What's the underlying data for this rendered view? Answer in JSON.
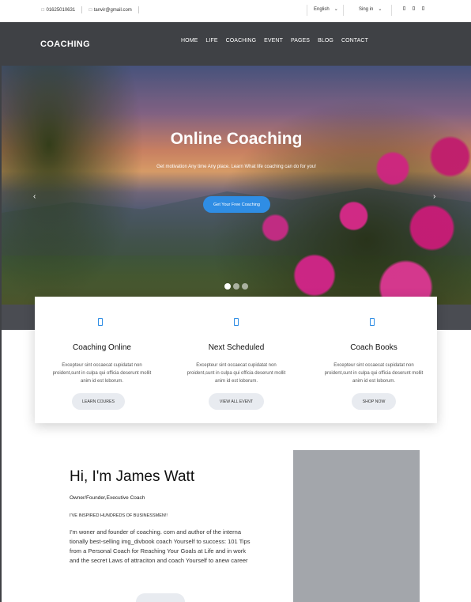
{
  "topbar": {
    "phone": "01625010631",
    "email": "tanvir@gmail.com",
    "language": "English",
    "signin": "Sing in",
    "phone_icon": "phone-icon",
    "email_icon": "mail-icon",
    "social_icons": [
      "facebook-icon",
      "twitter-icon",
      "instagram-icon"
    ]
  },
  "nav": {
    "brand": "COACHING",
    "items": [
      "HOME",
      "LIFE",
      "COACHING",
      "EVENT",
      "PAGES",
      "BLOG",
      "CONTACT"
    ]
  },
  "hero": {
    "title": "Online Coaching",
    "subtitle": "Get motivation Any time Any place. Learn What life coaching can do for you!",
    "cta_label": "Get Your Free Coaching",
    "slide_count": 3,
    "active_slide": 1
  },
  "cards": [
    {
      "icon": "monitor-icon",
      "title": "Coaching Online",
      "text": "Excepteur sint occaecat cupidatat non proident,sunt in culpa qui officia deserunt mollit anim id est loborum.",
      "button": "LEARN COURES"
    },
    {
      "icon": "calendar-icon",
      "title": "Next Scheduled",
      "text": "Excepteur sint occaecat cupidatat non proident,sunt in culpa qui officia deserunt mollit anim id est loborum.",
      "button": "VIEW ALL EVENT"
    },
    {
      "icon": "book-icon",
      "title": "Coach Books",
      "text": "Excepteur sint occaecat cupidatat non proident,sunt in culpa qui officia deserunt mollit anim id est loborum.",
      "button": "SHOP NOW"
    }
  ],
  "about": {
    "title": "Hi, I'm James Watt",
    "role": "Owner/Founder,Executive Coach",
    "tagline": "I'VE INSPIRED HUNDREDS OF BUSINESSMEN!!",
    "text": "I'm woner and founder of coaching. com and author of the interna tionally best-selling img_divbook coach Yourself to success: 101 Tips from a Personal Coach for Reaching Your Goals at Life and in work and the secret Laws of attraciton and coach Yourself to anew career"
  },
  "colors": {
    "accent": "#2f8de4",
    "nav_bg": "#3f4145",
    "button_bg": "#e8ebf0",
    "image_placeholder": "#a3a6ab"
  }
}
